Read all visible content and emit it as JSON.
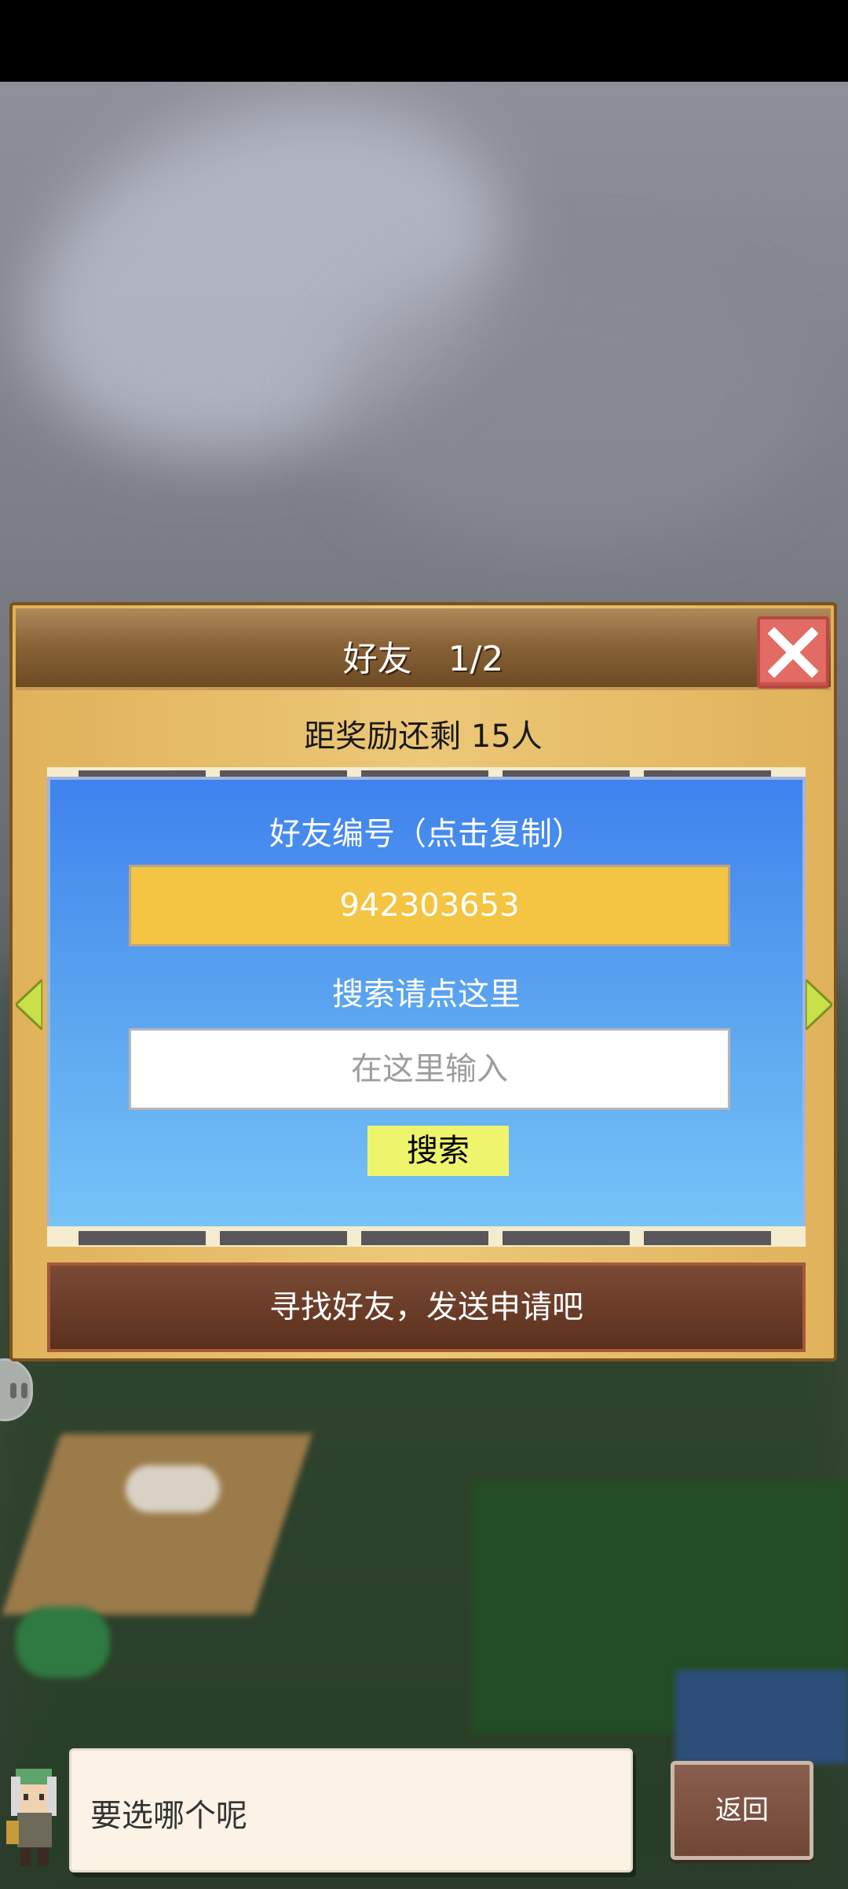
{
  "dialog": {
    "title": "好友",
    "page_indicator": "1/2",
    "reward_text": "距奖励还剩 15人",
    "friend_id_label": "好友编号（点击复制）",
    "friend_id": "942303653",
    "search_label": "搜索请点这里",
    "search_placeholder": "在这里输入",
    "search_button": "搜索",
    "find_friends_button": "寻找好友，发送申请吧"
  },
  "bottom": {
    "speech_text": "要选哪个呢",
    "back_button": "返回"
  },
  "colors": {
    "panel": "#ecc877",
    "header": "#8a6438",
    "close": "#e26b63",
    "card_blue": "#3f82ee",
    "friend_id_bg": "#f4c443",
    "search_btn": "#eef56c",
    "find_btn": "#6a3c27",
    "arrow": "#c8e04a"
  },
  "icons": [
    "close-icon",
    "arrow-left-icon",
    "arrow-right-icon",
    "character-portrait",
    "chat-bubble-icon"
  ]
}
